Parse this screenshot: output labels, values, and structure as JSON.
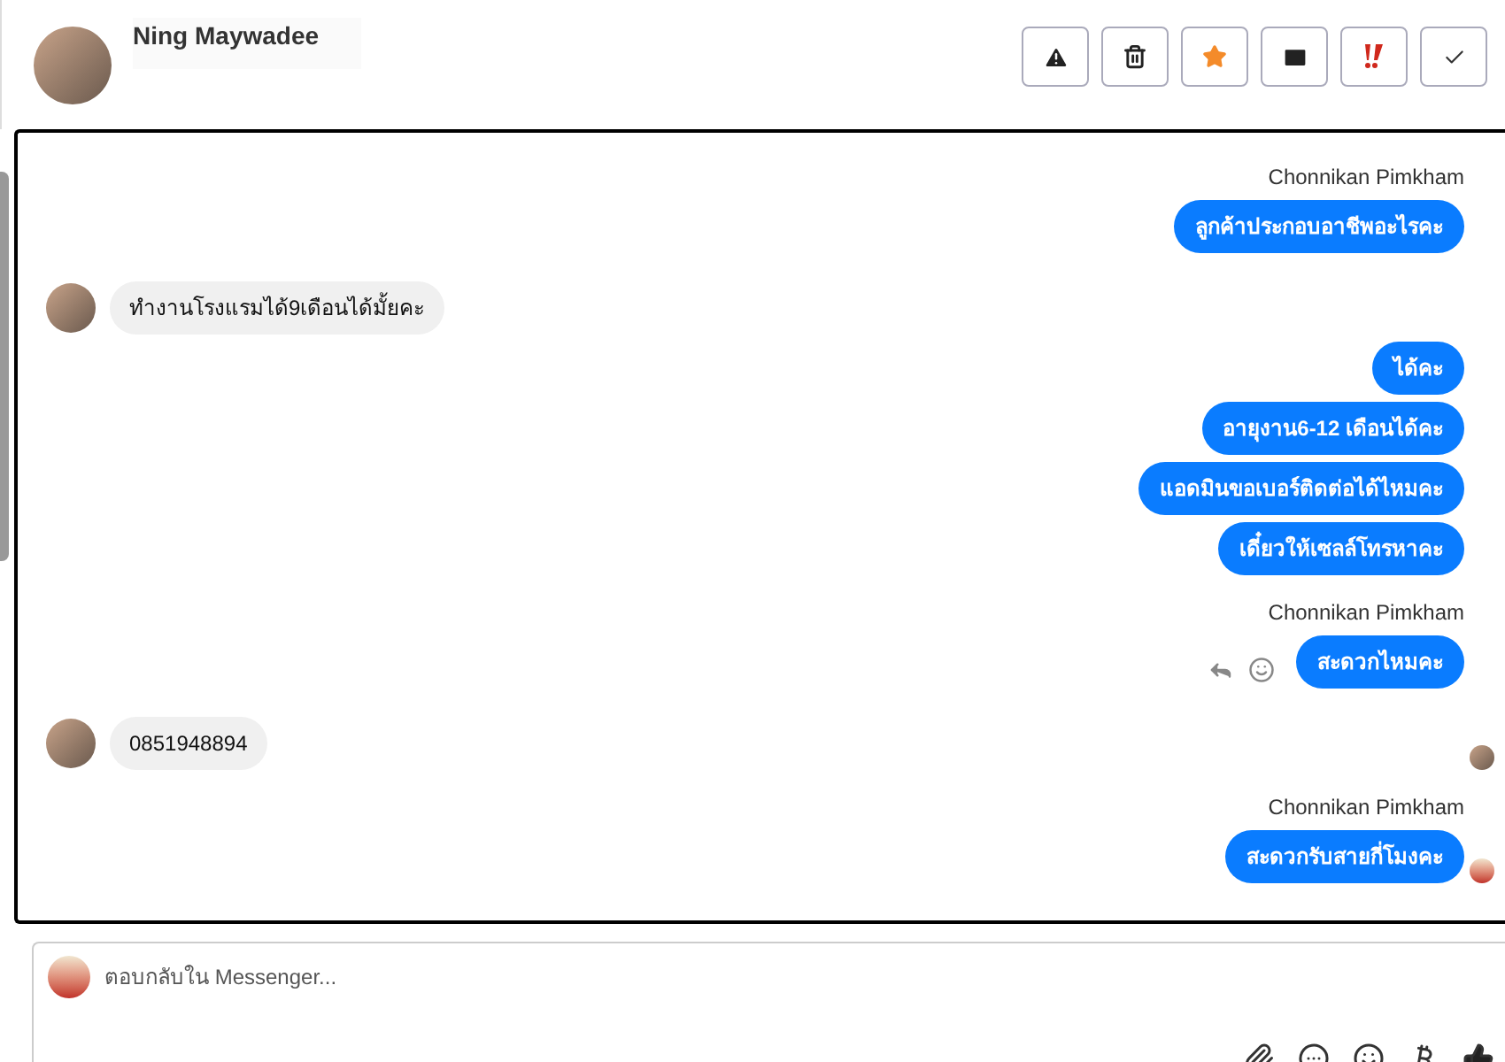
{
  "header": {
    "contact_name": "Ning Maywadee"
  },
  "toolbar": [
    {
      "kind": "warning"
    },
    {
      "kind": "trash"
    },
    {
      "kind": "star"
    },
    {
      "kind": "mail"
    },
    {
      "kind": "urgent"
    },
    {
      "kind": "done"
    }
  ],
  "messages": [
    {
      "kind": "sender",
      "text": "Chonnikan Pimkham"
    },
    {
      "kind": "out",
      "text": "ลูกค้าประกอบอาชีพอะไรคะ"
    },
    {
      "kind": "in",
      "text": "ทำงานโรงแรมได้9เดือนได้มั้ยคะ"
    },
    {
      "kind": "out",
      "text": "ได้คะ"
    },
    {
      "kind": "out",
      "text": "อายุงาน6-12 เดือนได้คะ"
    },
    {
      "kind": "out",
      "text": "แอดมินขอเบอร์ติดต่อได้ไหมคะ"
    },
    {
      "kind": "out",
      "text": "เดี๋ยวให้เซลล์โทรหาคะ"
    },
    {
      "kind": "sender",
      "text": "Chonnikan Pimkham"
    },
    {
      "kind": "out",
      "text": "สะดวกไหมคะ",
      "actions": true
    },
    {
      "kind": "in",
      "text": "0851948894"
    },
    {
      "kind": "seen"
    },
    {
      "kind": "sender",
      "text": "Chonnikan Pimkham"
    },
    {
      "kind": "out",
      "text": "สะดวกรับสายกี่โมงคะ",
      "seen": true
    }
  ],
  "composer": {
    "placeholder": "ตอบกลับใน Messenger..."
  },
  "composer_tools": [
    {
      "kind": "attach"
    },
    {
      "kind": "chat"
    },
    {
      "kind": "emoji"
    },
    {
      "kind": "baht"
    },
    {
      "kind": "like"
    }
  ]
}
